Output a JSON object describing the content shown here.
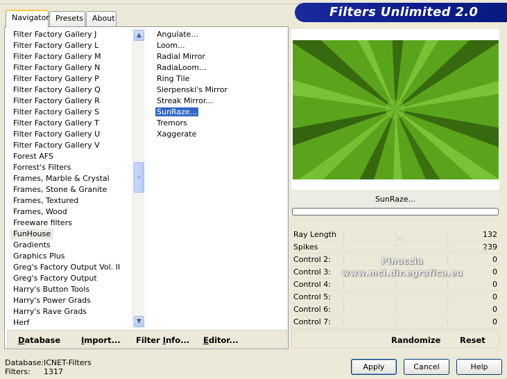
{
  "window": {
    "banner_title": "Filters Unlimited 2.0"
  },
  "tabs": [
    {
      "label": "Navigator"
    },
    {
      "label": "Presets"
    },
    {
      "label": "About"
    }
  ],
  "categories": [
    "Filter Factory Gallery J",
    "Filter Factory Gallery L",
    "Filter Factory Gallery M",
    "Filter Factory Gallery N",
    "Filter Factory Gallery P",
    "Filter Factory Gallery Q",
    "Filter Factory Gallery R",
    "Filter Factory Gallery S",
    "Filter Factory Gallery T",
    "Filter Factory Gallery U",
    "Filter Factory Gallery V",
    "Forest AFS",
    "Forrest's Filters",
    "Frames, Marble & Crystal",
    "Frames, Stone & Granite",
    "Frames, Textured",
    "Frames, Wood",
    "Freeware filters",
    "FunHouse",
    "Gradients",
    "Graphics Plus",
    "Greg's Factory Output Vol. II",
    "Greg's Factory Output",
    "Harry's Button Tools",
    "Harry's Power Grads",
    "Harry's Rave Grads",
    "Herf"
  ],
  "selected_category": "FunHouse",
  "filters": [
    "Angulate...",
    "Loom...",
    "Radial Mirror",
    "RadiaLoom...",
    "Ring Tile",
    "Sierpenski's Mirror",
    "Streak Mirror...",
    "SunRaze...",
    "Tremors",
    "Xaggerate"
  ],
  "selected_filter": "SunRaze...",
  "pane_buttons": {
    "database": {
      "underline": "D",
      "rest": "atabase"
    },
    "import": {
      "underline": "I",
      "rest": "mport..."
    },
    "filter_info": {
      "pre": "Filter ",
      "underline": "I",
      "rest": "nfo..."
    },
    "editor": {
      "underline": "E",
      "rest": "ditor..."
    }
  },
  "preview": {
    "filter_name": "SunRaze...",
    "progress": 0,
    "colors": {
      "base": "#5aa41c",
      "light": "#7cc83a",
      "dark": "#2e5a0c"
    }
  },
  "params": [
    {
      "label": "Ray Length",
      "value": "132",
      "level": 132
    },
    {
      "label": "Spikes",
      "value": "239",
      "level": 239
    },
    {
      "label": "Control 2:",
      "value": "0",
      "level": 0
    },
    {
      "label": "Control 3:",
      "value": "0",
      "level": 0
    },
    {
      "label": "Control 4:",
      "value": "0",
      "level": 0
    },
    {
      "label": "Control 5:",
      "value": "0",
      "level": 0
    },
    {
      "label": "Control 6:",
      "value": "0",
      "level": 0
    },
    {
      "label": "Control 7:",
      "value": "0",
      "level": 0
    }
  ],
  "watermark": {
    "line1": "Pinuccia",
    "line2": "www.mcl.dir.egrafica.eu"
  },
  "right_buttons": {
    "randomize": "Randomize",
    "reset": "Reset"
  },
  "status": {
    "database_label": "Database:",
    "database_value": "ICNET-Filters",
    "filters_label": "Filters:",
    "filters_value": "1317"
  },
  "dialog_buttons": {
    "apply": "Apply",
    "cancel": "Cancel",
    "help": "Help"
  }
}
